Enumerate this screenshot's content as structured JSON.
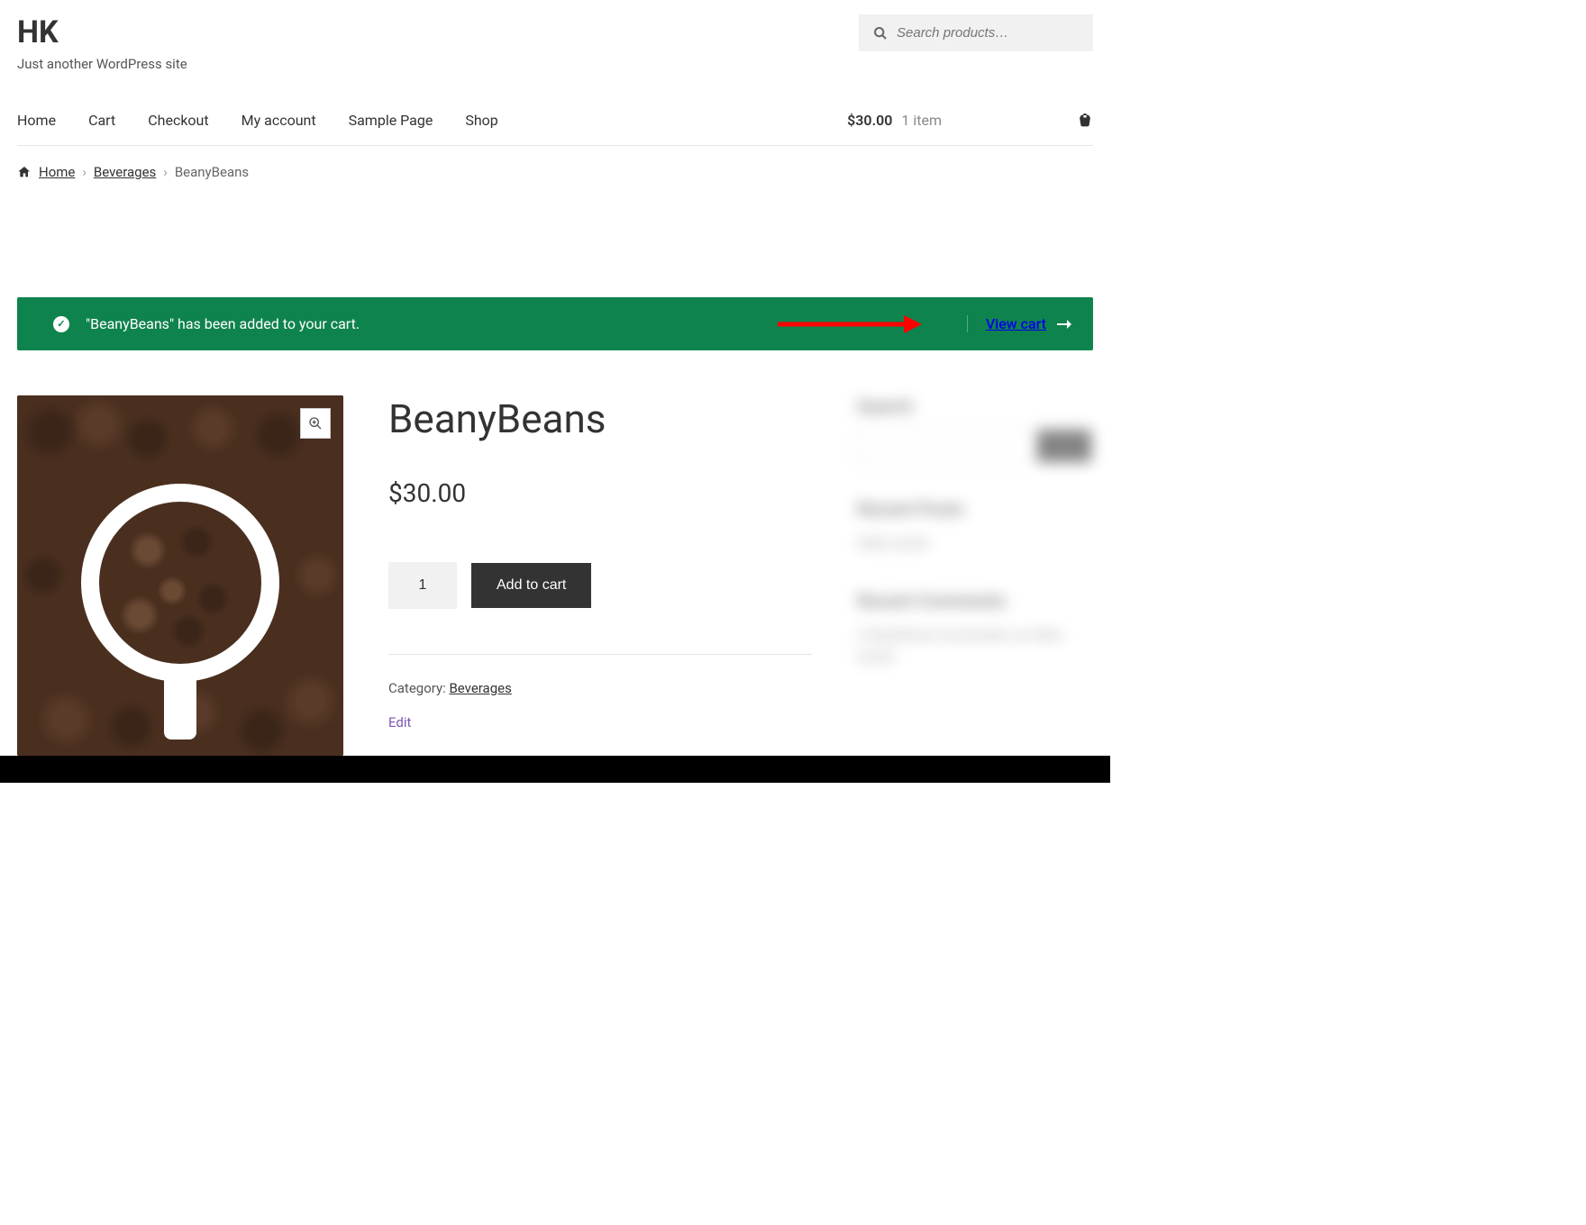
{
  "site": {
    "title": "HK",
    "tagline": "Just another WordPress site"
  },
  "search": {
    "placeholder": "Search products…"
  },
  "nav": {
    "items": [
      "Home",
      "Cart",
      "Checkout",
      "My account",
      "Sample Page",
      "Shop"
    ]
  },
  "header_cart": {
    "total": "$30.00",
    "count_label": "1 item"
  },
  "breadcrumb": {
    "home": "Home",
    "category": "Beverages",
    "current": "BeanyBeans"
  },
  "message": {
    "text": "\"BeanyBeans\" has been added to your cart.",
    "action": "View cart"
  },
  "product": {
    "title": "BeanyBeans",
    "price": "$30.00",
    "qty": "1",
    "add_to_cart": "Add to cart",
    "category_label": "Category: ",
    "category": "Beverages",
    "edit": "Edit"
  },
  "sidebar": {
    "search_label": "Search",
    "search_btn": "Search",
    "recent_posts_heading": "Recent Posts",
    "recent_posts_item": "Hello world!",
    "recent_comments_heading": "Recent Comments",
    "recent_comments_item": "A WordPress Commenter on Hello world!"
  }
}
